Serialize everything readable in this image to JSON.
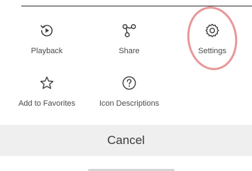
{
  "actions": {
    "playback": {
      "label": "Playback",
      "icon": "replay-play-icon"
    },
    "share": {
      "label": "Share",
      "icon": "share-nodes-icon"
    },
    "settings": {
      "label": "Settings",
      "icon": "gear-icon"
    },
    "favorites": {
      "label": "Add to Favorites",
      "icon": "star-icon"
    },
    "icon_descriptions": {
      "label": "Icon Descriptions",
      "icon": "question-circle-icon"
    }
  },
  "cancel_label": "Cancel",
  "colors": {
    "icon": "#3c3c3c",
    "label": "#4a4a4a",
    "highlight": "#e58c8e",
    "cancel_bg": "#efefef"
  }
}
